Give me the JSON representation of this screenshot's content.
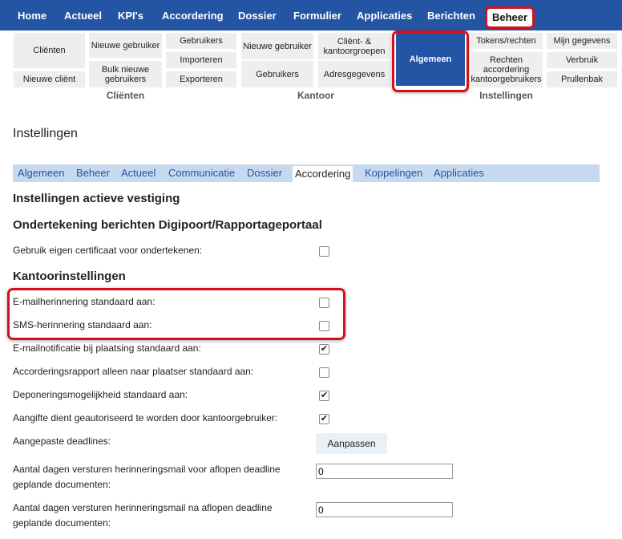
{
  "topnav": {
    "items": [
      "Home",
      "Actueel",
      "KPI's",
      "Accordering",
      "Dossier",
      "Formulier",
      "Applicaties",
      "Berichten"
    ],
    "active": "Beheer"
  },
  "ribbon": {
    "clienten": {
      "label": "Cliënten",
      "tiles": [
        "Cliënten",
        "Nieuwe cliënt",
        "Nieuwe gebruiker",
        "Bulk nieuwe gebruikers",
        "Gebruikers",
        "Importeren",
        "Exporteren"
      ]
    },
    "kantoor": {
      "label": "Kantoor",
      "tiles": [
        "Nieuwe gebruiker",
        "Gebruikers",
        "Cliënt- & kantoorgroepen",
        "Adresgegevens"
      ]
    },
    "instellingen": {
      "label": "Instellingen",
      "tiles": [
        "Algemeen",
        "Tokens/rechten",
        "Rechten accordering kantoorgebruikers",
        "Mijn gegevens",
        "Verbruik",
        "Prullenbak"
      ]
    }
  },
  "page": {
    "title": "Instellingen",
    "tabs": [
      "Algemeen",
      "Beheer",
      "Actueel",
      "Communicatie",
      "Dossier",
      "Accordering",
      "Koppelingen",
      "Applicaties"
    ],
    "active_tab": "Accordering"
  },
  "sections": {
    "vestiging": "Instellingen actieve vestiging",
    "digipoort": "Ondertekening berichten Digipoort/Rapportageportaal",
    "kantoor": "Kantoorinstellingen"
  },
  "settings": {
    "eigen_certificaat": {
      "label": "Gebruik eigen certificaat voor ondertekenen:",
      "checked": false
    },
    "email_herinnering": {
      "label": "E-mailherinnering standaard aan:",
      "checked": false
    },
    "sms_herinnering": {
      "label": "SMS-herinnering standaard aan:",
      "checked": false
    },
    "email_notificatie": {
      "label": "E-mailnotificatie bij plaatsing standaard aan:",
      "checked": true
    },
    "accorderingsrapport": {
      "label": "Accorderingsrapport alleen naar plaatser standaard aan:",
      "checked": false
    },
    "deponering": {
      "label": "Deponeringsmogelijkheid standaard aan:",
      "checked": true
    },
    "autorisatie": {
      "label": "Aangifte dient geautoriseerd te worden door kantoorgebruiker:",
      "checked": true
    },
    "deadlines": {
      "label": "Aangepaste deadlines:",
      "button": "Aanpassen"
    },
    "dagen_voor": {
      "label": "Aantal dagen versturen herinneringsmail voor aflopen deadline geplande documenten:",
      "value": "0"
    },
    "dagen_na": {
      "label": "Aantal dagen versturen herinneringsmail na aflopen deadline geplande documenten:",
      "value": "0"
    }
  },
  "colors": {
    "nav": "#2355a4",
    "highlight": "#d4111b",
    "tabbar": "#c7d9ef",
    "tab_text": "#2255a3"
  },
  "checkmark_glyph": "✔"
}
